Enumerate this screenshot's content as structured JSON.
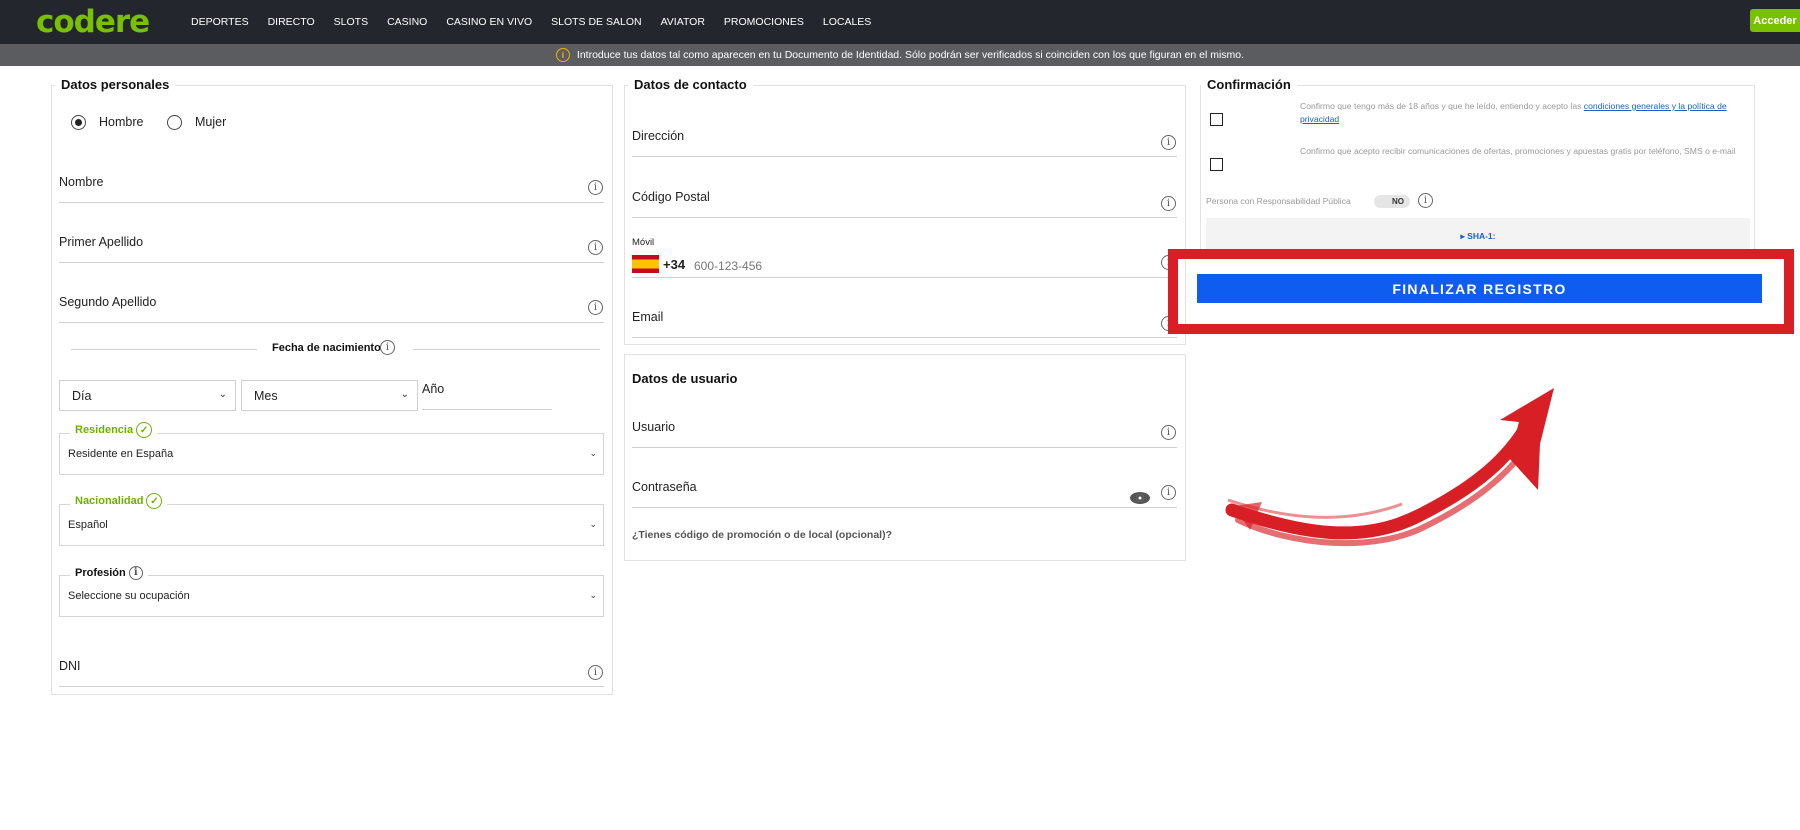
{
  "header": {
    "logo": "codere",
    "nav": [
      "DEPORTES",
      "DIRECTO",
      "SLOTS",
      "CASINO",
      "CASINO EN VIVO",
      "SLOTS DE SALON",
      "AVIATOR",
      "PROMOCIONES",
      "LOCALES"
    ],
    "login_label": "Acceder"
  },
  "notice": {
    "text": "Introduce tus datos tal como aparecen en tu Documento de Identidad. Sólo podrán ser verificados si coinciden con los que figuran en el mismo."
  },
  "personal": {
    "title": "Datos personales",
    "gender": {
      "male": "Hombre",
      "female": "Mujer",
      "selected": "Hombre"
    },
    "fields": {
      "nombre": "Nombre",
      "primer_apellido": "Primer Apellido",
      "segundo_apellido": "Segundo Apellido",
      "dni": "DNI"
    },
    "dob": {
      "title": "Fecha de nacimiento",
      "day": "Día",
      "month": "Mes",
      "year": "Año"
    },
    "residencia": {
      "label": "Residencia",
      "value": "Residente en España"
    },
    "nacionalidad": {
      "label": "Nacionalidad",
      "value": "Español"
    },
    "profesion": {
      "label": "Profesión",
      "value": "Seleccione su ocupación"
    }
  },
  "contact": {
    "title": "Datos de contacto",
    "direccion": "Dirección",
    "codigo_postal": "Código Postal",
    "movil": {
      "label": "Móvil",
      "prefix": "+34",
      "placeholder": "600-123-456"
    },
    "email": "Email"
  },
  "user": {
    "title": "Datos de usuario",
    "usuario": "Usuario",
    "contrasena": "Contraseña",
    "promo": "¿Tienes código de promoción o de local (opcional)?"
  },
  "confirm": {
    "title": "Confirmación",
    "terms_text": "Confirmo que tengo más de 18 años y que he leído, entiendo y acepto las ",
    "terms_link": "condiciones generales y la política de privacidad",
    "comms_text": "Confirmo que acepto recibir comunicaciones de ofertas, promociones y apuestas gratis por teléfono, SMS o e-mail",
    "pep_label": "Persona con Responsabilidad Pública",
    "pep_toggle": "NO",
    "sha": "▸ SHA-1:",
    "submit": "FINALIZAR REGISTRO"
  },
  "colors": {
    "brand_green": "#79c000",
    "primary_blue": "#0f5cf0",
    "annotation_red": "#d81f26"
  }
}
